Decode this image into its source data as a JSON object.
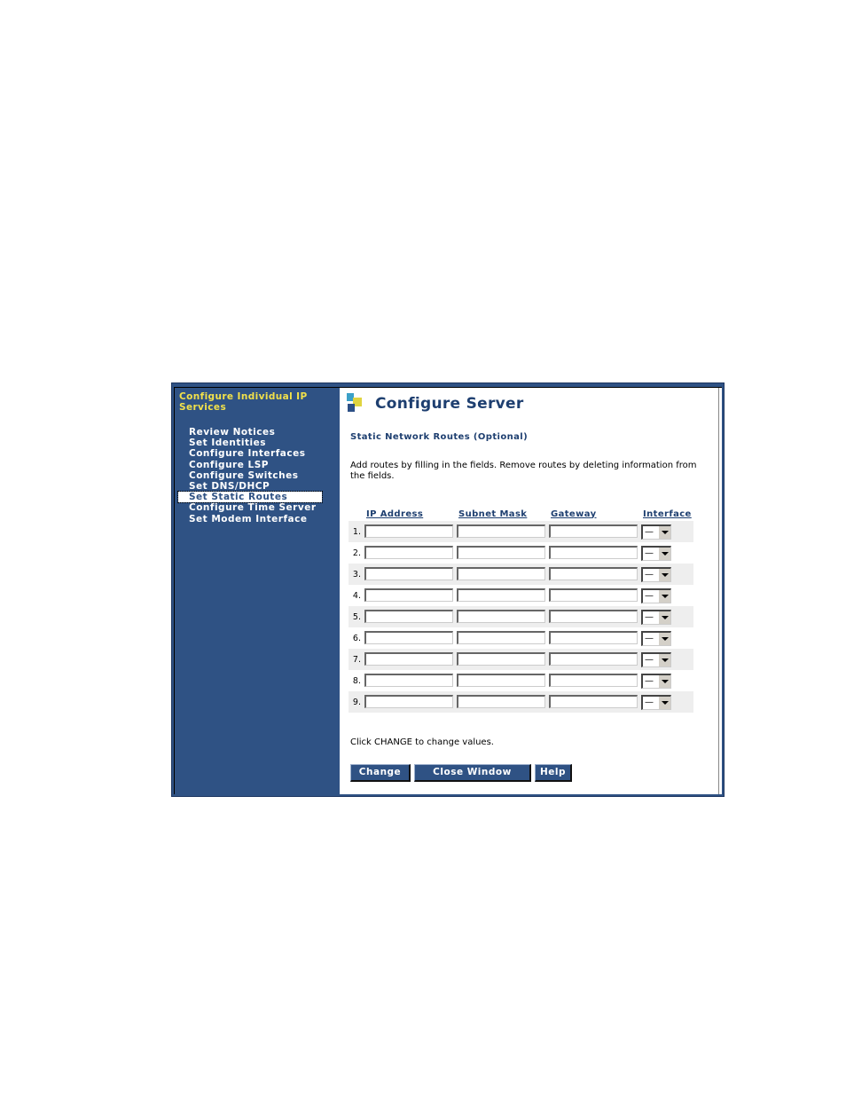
{
  "sidebar": {
    "title": "Configure Individual IP Services",
    "items": [
      {
        "label": "Review Notices",
        "active": false
      },
      {
        "label": "Set Identities",
        "active": false
      },
      {
        "label": "Configure Interfaces",
        "active": false
      },
      {
        "label": "Configure LSP",
        "active": false
      },
      {
        "label": "Configure Switches",
        "active": false
      },
      {
        "label": "Set DNS/DHCP",
        "active": false
      },
      {
        "label": "Set Static Routes",
        "active": true
      },
      {
        "label": "Configure Time Server",
        "active": false
      },
      {
        "label": "Set Modem Interface",
        "active": false
      }
    ]
  },
  "header": {
    "title": "Configure Server",
    "logo": "colored-squares-logo"
  },
  "section_title": "Static Network Routes (Optional)",
  "description": "Add routes by filling in the fields. Remove routes by deleting information from the fields.",
  "table": {
    "columns": [
      "IP Address",
      "Subnet Mask",
      "Gateway",
      "Interface"
    ],
    "rows": [
      {
        "num": "1.",
        "ip": "",
        "mask": "",
        "gateway": "",
        "interface": "—"
      },
      {
        "num": "2.",
        "ip": "",
        "mask": "",
        "gateway": "",
        "interface": "—"
      },
      {
        "num": "3.",
        "ip": "",
        "mask": "",
        "gateway": "",
        "interface": "—"
      },
      {
        "num": "4.",
        "ip": "",
        "mask": "",
        "gateway": "",
        "interface": "—"
      },
      {
        "num": "5.",
        "ip": "",
        "mask": "",
        "gateway": "",
        "interface": "—"
      },
      {
        "num": "6.",
        "ip": "",
        "mask": "",
        "gateway": "",
        "interface": "—"
      },
      {
        "num": "7.",
        "ip": "",
        "mask": "",
        "gateway": "",
        "interface": "—"
      },
      {
        "num": "8.",
        "ip": "",
        "mask": "",
        "gateway": "",
        "interface": "—"
      },
      {
        "num": "9.",
        "ip": "",
        "mask": "",
        "gateway": "",
        "interface": "—"
      }
    ]
  },
  "note": "Click CHANGE to change values.",
  "buttons": {
    "change": "Change",
    "close": "Close Window",
    "help": "Help"
  }
}
